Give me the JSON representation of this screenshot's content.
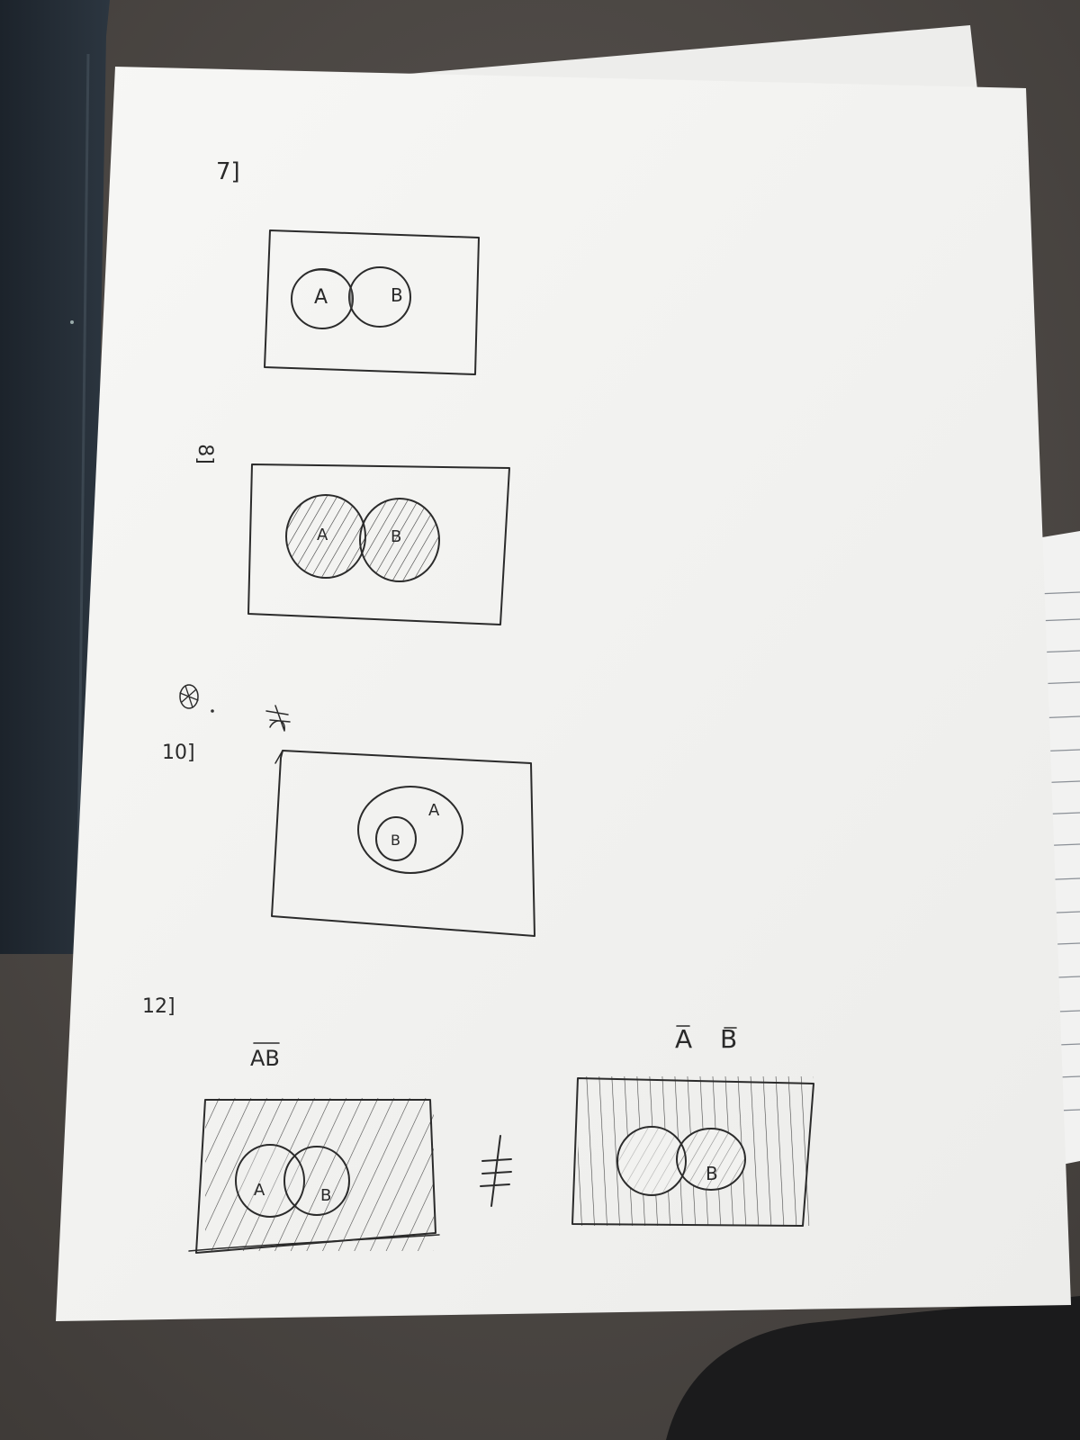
{
  "problems": {
    "p7": {
      "number": "7]",
      "circle_a": "A",
      "circle_b": "B"
    },
    "p8": {
      "number": "8]",
      "circle_a": "A",
      "circle_b": "B"
    },
    "p9": {
      "number": "9]"
    },
    "p10": {
      "number": "10]",
      "circle_a": "A",
      "circle_b": "B"
    },
    "p12": {
      "number": "12]",
      "left_title": "AB",
      "right_title_a": "A",
      "right_title_b": "B",
      "not_equal": "≠",
      "left_a": "A",
      "left_b": "B",
      "right_b": "B"
    }
  },
  "colors": {
    "desk": "#4a4643",
    "paper": "#f4f4f2",
    "pencil": "#2b2b2b"
  }
}
